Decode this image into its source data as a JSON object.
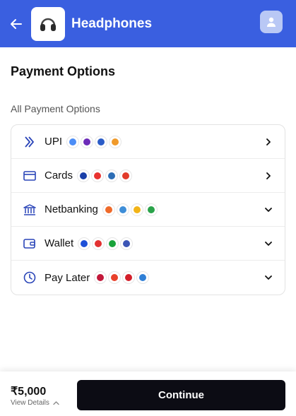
{
  "header": {
    "title": "Headphones",
    "back_icon": "arrow-left-icon",
    "logo_icon": "headphones-product-image",
    "profile_icon": "user-icon",
    "bg_color": "#3a5fe0"
  },
  "payment": {
    "section_title": "Payment Options",
    "all_options_label": "All Payment Options",
    "methods": [
      {
        "label": "UPI",
        "icon": "upi-icon",
        "arrow": "chevron-right-icon",
        "chips": [
          "#4c8df6",
          "#6c2bb8",
          "#2b5cc7",
          "#f09a2a"
        ]
      },
      {
        "label": "Cards",
        "icon": "credit-card-icon",
        "arrow": "chevron-right-icon",
        "chips": [
          "#1a3fa8",
          "#e8322f",
          "#2c6db5",
          "#e23b2a"
        ]
      },
      {
        "label": "Netbanking",
        "icon": "bank-icon",
        "arrow": "chevron-down-icon",
        "chips": [
          "#ef6a2a",
          "#3e8ed8",
          "#f2b418",
          "#2aa34a"
        ]
      },
      {
        "label": "Wallet",
        "icon": "wallet-icon",
        "arrow": "chevron-down-icon",
        "chips": [
          "#1c4fd8",
          "#e23030",
          "#18a33a",
          "#3b55b5"
        ]
      },
      {
        "label": "Pay Later",
        "icon": "clock-icon",
        "arrow": "chevron-down-icon",
        "chips": [
          "#c2183a",
          "#e8402a",
          "#d31f2a",
          "#2f7fd6"
        ]
      }
    ]
  },
  "footer": {
    "amount": "₹5,000",
    "view_details": "View Details",
    "continue_label": "Continue"
  }
}
